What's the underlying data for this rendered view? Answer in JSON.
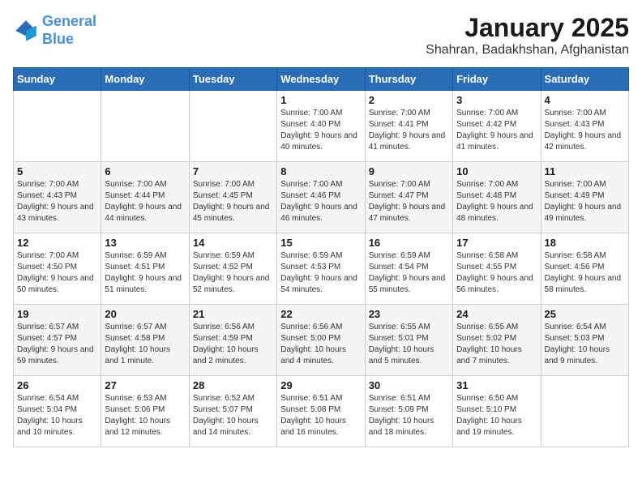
{
  "header": {
    "logo_line1": "General",
    "logo_line2": "Blue",
    "month": "January 2025",
    "location": "Shahran, Badakhshan, Afghanistan"
  },
  "weekdays": [
    "Sunday",
    "Monday",
    "Tuesday",
    "Wednesday",
    "Thursday",
    "Friday",
    "Saturday"
  ],
  "weeks": [
    [
      {
        "day": "",
        "info": ""
      },
      {
        "day": "",
        "info": ""
      },
      {
        "day": "",
        "info": ""
      },
      {
        "day": "1",
        "info": "Sunrise: 7:00 AM\nSunset: 4:40 PM\nDaylight: 9 hours\nand 40 minutes."
      },
      {
        "day": "2",
        "info": "Sunrise: 7:00 AM\nSunset: 4:41 PM\nDaylight: 9 hours\nand 41 minutes."
      },
      {
        "day": "3",
        "info": "Sunrise: 7:00 AM\nSunset: 4:42 PM\nDaylight: 9 hours\nand 41 minutes."
      },
      {
        "day": "4",
        "info": "Sunrise: 7:00 AM\nSunset: 4:43 PM\nDaylight: 9 hours\nand 42 minutes."
      }
    ],
    [
      {
        "day": "5",
        "info": "Sunrise: 7:00 AM\nSunset: 4:43 PM\nDaylight: 9 hours\nand 43 minutes."
      },
      {
        "day": "6",
        "info": "Sunrise: 7:00 AM\nSunset: 4:44 PM\nDaylight: 9 hours\nand 44 minutes."
      },
      {
        "day": "7",
        "info": "Sunrise: 7:00 AM\nSunset: 4:45 PM\nDaylight: 9 hours\nand 45 minutes."
      },
      {
        "day": "8",
        "info": "Sunrise: 7:00 AM\nSunset: 4:46 PM\nDaylight: 9 hours\nand 46 minutes."
      },
      {
        "day": "9",
        "info": "Sunrise: 7:00 AM\nSunset: 4:47 PM\nDaylight: 9 hours\nand 47 minutes."
      },
      {
        "day": "10",
        "info": "Sunrise: 7:00 AM\nSunset: 4:48 PM\nDaylight: 9 hours\nand 48 minutes."
      },
      {
        "day": "11",
        "info": "Sunrise: 7:00 AM\nSunset: 4:49 PM\nDaylight: 9 hours\nand 49 minutes."
      }
    ],
    [
      {
        "day": "12",
        "info": "Sunrise: 7:00 AM\nSunset: 4:50 PM\nDaylight: 9 hours\nand 50 minutes."
      },
      {
        "day": "13",
        "info": "Sunrise: 6:59 AM\nSunset: 4:51 PM\nDaylight: 9 hours\nand 51 minutes."
      },
      {
        "day": "14",
        "info": "Sunrise: 6:59 AM\nSunset: 4:52 PM\nDaylight: 9 hours\nand 52 minutes."
      },
      {
        "day": "15",
        "info": "Sunrise: 6:59 AM\nSunset: 4:53 PM\nDaylight: 9 hours\nand 54 minutes."
      },
      {
        "day": "16",
        "info": "Sunrise: 6:59 AM\nSunset: 4:54 PM\nDaylight: 9 hours\nand 55 minutes."
      },
      {
        "day": "17",
        "info": "Sunrise: 6:58 AM\nSunset: 4:55 PM\nDaylight: 9 hours\nand 56 minutes."
      },
      {
        "day": "18",
        "info": "Sunrise: 6:58 AM\nSunset: 4:56 PM\nDaylight: 9 hours\nand 58 minutes."
      }
    ],
    [
      {
        "day": "19",
        "info": "Sunrise: 6:57 AM\nSunset: 4:57 PM\nDaylight: 9 hours\nand 59 minutes."
      },
      {
        "day": "20",
        "info": "Sunrise: 6:57 AM\nSunset: 4:58 PM\nDaylight: 10 hours\nand 1 minute."
      },
      {
        "day": "21",
        "info": "Sunrise: 6:56 AM\nSunset: 4:59 PM\nDaylight: 10 hours\nand 2 minutes."
      },
      {
        "day": "22",
        "info": "Sunrise: 6:56 AM\nSunset: 5:00 PM\nDaylight: 10 hours\nand 4 minutes."
      },
      {
        "day": "23",
        "info": "Sunrise: 6:55 AM\nSunset: 5:01 PM\nDaylight: 10 hours\nand 5 minutes."
      },
      {
        "day": "24",
        "info": "Sunrise: 6:55 AM\nSunset: 5:02 PM\nDaylight: 10 hours\nand 7 minutes."
      },
      {
        "day": "25",
        "info": "Sunrise: 6:54 AM\nSunset: 5:03 PM\nDaylight: 10 hours\nand 9 minutes."
      }
    ],
    [
      {
        "day": "26",
        "info": "Sunrise: 6:54 AM\nSunset: 5:04 PM\nDaylight: 10 hours\nand 10 minutes."
      },
      {
        "day": "27",
        "info": "Sunrise: 6:53 AM\nSunset: 5:06 PM\nDaylight: 10 hours\nand 12 minutes."
      },
      {
        "day": "28",
        "info": "Sunrise: 6:52 AM\nSunset: 5:07 PM\nDaylight: 10 hours\nand 14 minutes."
      },
      {
        "day": "29",
        "info": "Sunrise: 6:51 AM\nSunset: 5:08 PM\nDaylight: 10 hours\nand 16 minutes."
      },
      {
        "day": "30",
        "info": "Sunrise: 6:51 AM\nSunset: 5:09 PM\nDaylight: 10 hours\nand 18 minutes."
      },
      {
        "day": "31",
        "info": "Sunrise: 6:50 AM\nSunset: 5:10 PM\nDaylight: 10 hours\nand 19 minutes."
      },
      {
        "day": "",
        "info": ""
      }
    ]
  ]
}
